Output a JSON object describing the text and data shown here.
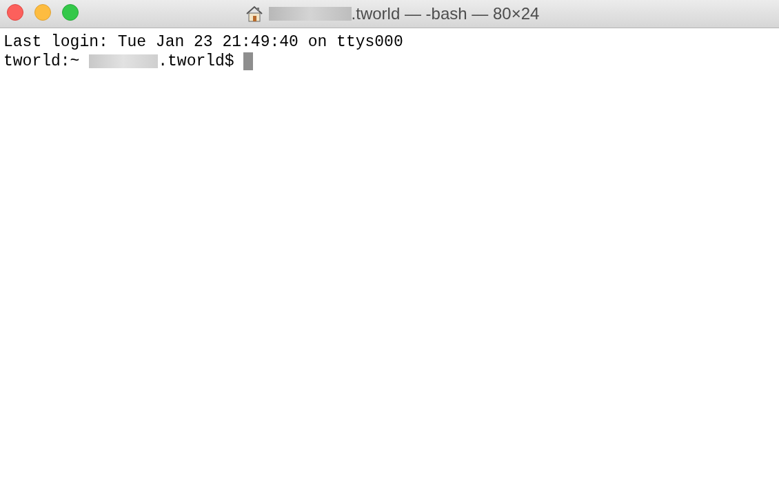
{
  "window": {
    "title_parts": [
      {
        "kind": "redaction"
      },
      {
        "kind": "text",
        "text": ".tworld — -bash — 80×24"
      }
    ]
  },
  "terminal": {
    "lines": [
      {
        "segments": [
          {
            "kind": "text",
            "text": "Last login: Tue Jan 23 21:49:40 on ttys000"
          }
        ],
        "cursor": false
      },
      {
        "segments": [
          {
            "kind": "text",
            "text": "tworld:~ "
          },
          {
            "kind": "redaction"
          },
          {
            "kind": "text",
            "text": ".tworld$ "
          }
        ],
        "cursor": true
      }
    ]
  }
}
